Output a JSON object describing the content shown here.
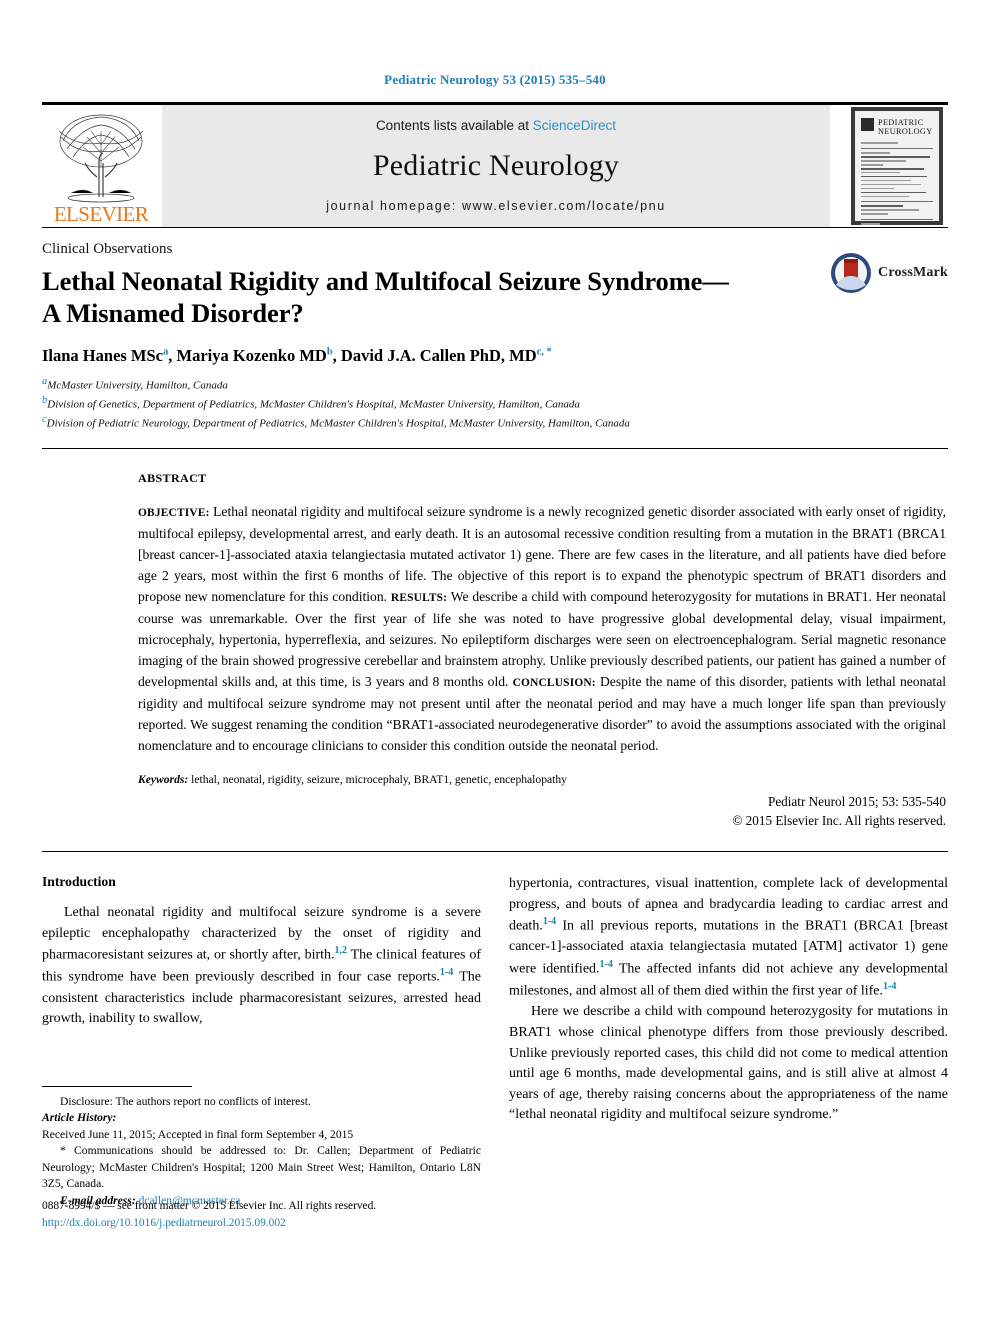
{
  "running_head": "Pediatric Neurology 53 (2015) 535–540",
  "masthead": {
    "publisher_name": "ELSEVIER",
    "contents_prefix": "Contents lists available at ",
    "contents_link": "ScienceDirect",
    "journal_title": "Pediatric Neurology",
    "homepage": "journal homepage: www.elsevier.com/locate/pnu",
    "cover": {
      "title_line1": "PEDIATRIC",
      "title_line2": "NEUROLOGY"
    }
  },
  "article": {
    "section_label": "Clinical Observations",
    "title": "Lethal Neonatal Rigidity and Multifocal Seizure Syndrome—A Misnamed Disorder?",
    "crossmark_label": "CrossMark",
    "authors": [
      {
        "name": "Ilana Hanes MSc",
        "marker": "a",
        "sep": ", "
      },
      {
        "name": "Mariya Kozenko MD",
        "marker": "b",
        "sep": ", "
      },
      {
        "name": "David J.A. Callen PhD, MD",
        "marker": "c, *",
        "sep": ""
      }
    ],
    "affiliations": [
      {
        "marker": "a",
        "text": "McMaster University, Hamilton, Canada"
      },
      {
        "marker": "b",
        "text": "Division of Genetics, Department of Pediatrics, McMaster Children's Hospital, McMaster University, Hamilton, Canada"
      },
      {
        "marker": "c",
        "text": "Division of Pediatric Neurology, Department of Pediatrics, McMaster Children's Hospital, McMaster University, Hamilton, Canada"
      }
    ]
  },
  "abstract": {
    "heading": "ABSTRACT",
    "objective_label": "OBJECTIVE:",
    "objective_text": " Lethal neonatal rigidity and multifocal seizure syndrome is a newly recognized genetic disorder associated with early onset of rigidity, multifocal epilepsy, developmental arrest, and early death. It is an autosomal recessive condition resulting from a mutation in the BRAT1 (BRCA1 [breast cancer-1]-associated ataxia telangiectasia mutated activator 1) gene. There are few cases in the literature, and all patients have died before age 2 years, most within the first 6 months of life. The objective of this report is to expand the phenotypic spectrum of BRAT1 disorders and propose new nomenclature for this condition. ",
    "results_label": "RESULTS:",
    "results_text": " We describe a child with compound heterozygosity for mutations in BRAT1. Her neonatal course was unremarkable. Over the first year of life she was noted to have progressive global developmental delay, visual impairment, microcephaly, hypertonia, hyperreflexia, and seizures. No epileptiform discharges were seen on electroencephalogram. Serial magnetic resonance imaging of the brain showed progressive cerebellar and brainstem atrophy. Unlike previously described patients, our patient has gained a number of developmental skills and, at this time, is 3 years and 8 months old. ",
    "conclusion_label": "CONCLUSION:",
    "conclusion_text": " Despite the name of this disorder, patients with lethal neonatal rigidity and multifocal seizure syndrome may not present until after the neonatal period and may have a much longer life span than previously reported. We suggest renaming the condition “BRAT1-associated neurodegenerative disorder” to avoid the assumptions associated with the original nomenclature and to encourage clinicians to consider this condition outside the neonatal period.",
    "keywords_label": "Keywords:",
    "keywords_text": " lethal, neonatal, rigidity, seizure, microcephaly, BRAT1, genetic, encephalopathy",
    "citation": "Pediatr Neurol 2015; 53: 535-540",
    "copyright": "© 2015 Elsevier Inc. All rights reserved."
  },
  "body": {
    "intro_heading": "Introduction",
    "left_p1_a": "Lethal neonatal rigidity and multifocal seizure syndrome is a severe epileptic encephalopathy characterized by the onset of rigidity and pharmacoresistant seizures at, or shortly after, birth.",
    "left_p1_ref1": "1,2",
    "left_p1_b": " The clinical features of this syndrome have been previously described in four case reports.",
    "left_p1_ref2": "1-4",
    "left_p1_c": " The consistent characteristics include pharmacoresistant seizures, arrested head growth, inability to swallow,",
    "right_p1_a": "hypertonia, contractures, visual inattention, complete lack of developmental progress, and bouts of apnea and bradycardia leading to cardiac arrest and death.",
    "right_p1_ref1": "1-4",
    "right_p1_b": " In all previous reports, mutations in the BRAT1 (BRCA1 [breast cancer-1]-associated ataxia telangiectasia mutated [ATM] activator 1) gene were identified.",
    "right_p1_ref2": "1-4",
    "right_p1_c": " The affected infants did not achieve any developmental milestones, and almost all of them died within the first year of life.",
    "right_p1_ref3": "1-4",
    "right_p2_a": "Here we describe a child with compound heterozygosity for mutations in BRAT1 whose clinical phenotype differs from those previously described. Unlike previously reported cases, this child did not come to medical attention until age 6 months, made developmental gains, and is still alive at almost 4 years of age, thereby raising concerns about the appropriateness of the name “lethal neonatal rigidity and multifocal seizure syndrome.”"
  },
  "footnotes": {
    "disclosure": "Disclosure: The authors report no conflicts of interest.",
    "article_history_label": "Article History:",
    "article_history": "Received June 11, 2015; Accepted in final form September 4, 2015",
    "correspondence": "* Communications should be addressed to: Dr. Callen; Department of Pediatric Neurology; McMaster Children's Hospital; 1200 Main Street West; Hamilton, Ontario L8N 3Z5, Canada.",
    "email_label": "E-mail address:",
    "email": "dcallen@mcmaster.ca"
  },
  "page_footer": {
    "issn_line": "0887-8994/$ — see front matter © 2015 Elsevier Inc. All rights reserved.",
    "doi": "http://dx.doi.org/10.1016/j.pediatrneurol.2015.09.002"
  }
}
